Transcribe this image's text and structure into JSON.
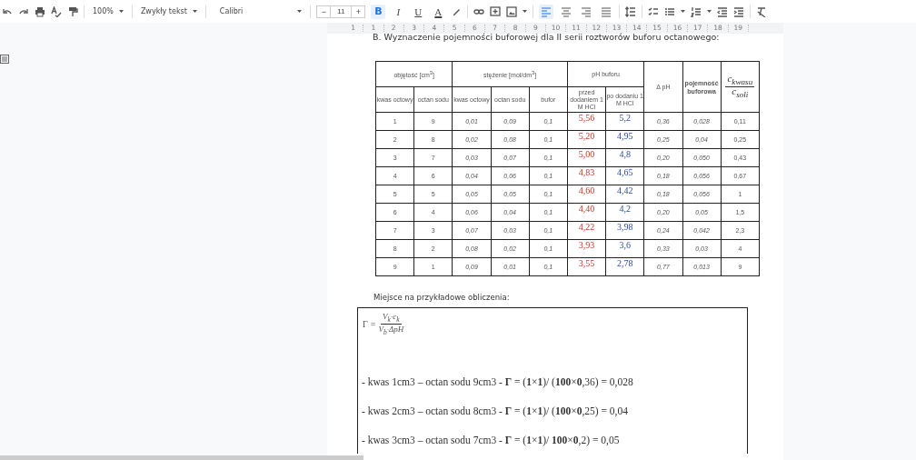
{
  "toolbar": {
    "zoom": "100%",
    "paragraph_style": "Zwykły tekst",
    "font": "Calibri",
    "font_size": "11",
    "size_decrease": "−",
    "size_increase": "+",
    "format_buttons": [
      {
        "kind": "bold",
        "label": "B",
        "selected": true
      },
      {
        "kind": "italic",
        "label": "I",
        "selected": false
      },
      {
        "kind": "underline",
        "label": "U",
        "selected": false
      },
      {
        "kind": "color",
        "label": "A",
        "selected": false
      }
    ],
    "alignment": [
      {
        "kind": "left",
        "selected": true
      },
      {
        "kind": "center",
        "selected": false
      },
      {
        "kind": "right",
        "selected": false
      },
      {
        "kind": "justify",
        "selected": false
      }
    ]
  },
  "ruler": {
    "labels": [
      "1",
      "1",
      "2",
      "3",
      "4",
      "5",
      "6",
      "7",
      "8",
      "9",
      "10",
      "11",
      "12",
      "13",
      "14",
      "15",
      "16",
      "17",
      "18",
      "19"
    ]
  },
  "document": {
    "heading": "B. Wyznaczenie pojemności buforowej dla II serii roztworów buforu octanowego:",
    "table": {
      "header_groups": [
        {
          "kind": "group",
          "label": "objętość [cm$^{3}$]",
          "columns": [
            "kwas octowy",
            "octan sodu"
          ]
        },
        {
          "kind": "group",
          "label": "stężenie [mol/dm$^{3}$]",
          "columns": [
            "kwas octowy",
            "octan sodu",
            "bufor"
          ]
        },
        {
          "kind": "group",
          "label": "pH buforu",
          "columns": [
            "przed dodaniem 1 M HCl",
            "po dodaniu 1 M HCl"
          ]
        },
        {
          "kind": "single",
          "label": "Δ pH"
        },
        {
          "kind": "single",
          "label": "pojemność buforowa"
        },
        {
          "kind": "fraction",
          "numerator": "c$_{kwasu}$",
          "denominator": "c$_{soli}$"
        }
      ],
      "rows": [
        [
          "1",
          "9",
          "0,01",
          "0,09",
          "0,1",
          "5,56",
          "5,2",
          "0,36",
          "0,028",
          "0,11"
        ],
        [
          "2",
          "8",
          "0,02",
          "0,08",
          "0,1",
          "5,20",
          "4,95",
          "0,25",
          "0,04",
          "0,25"
        ],
        [
          "3",
          "7",
          "0,03",
          "0,07",
          "0,1",
          "5,00",
          "4,8",
          "0,20",
          "0,050",
          "0,43"
        ],
        [
          "4",
          "6",
          "0,04",
          "0,06",
          "0,1",
          "4,83",
          "4,65",
          "0,18",
          "0,056",
          "0,67"
        ],
        [
          "5",
          "5",
          "0,05",
          "0,05",
          "0,1",
          "4,60",
          "4,42",
          "0,18",
          "0,056",
          "1"
        ],
        [
          "6",
          "4",
          "0,06",
          "0,04",
          "0,1",
          "4,40",
          "4,2",
          "0,20",
          "0,05",
          "1,5"
        ],
        [
          "7",
          "3",
          "0,07",
          "0,03",
          "0,1",
          "4,22",
          "3,98",
          "0,24",
          "0,042",
          "2,3"
        ],
        [
          "8",
          "2",
          "0,08",
          "0,02",
          "0,1",
          "3,93",
          "3,6",
          "0,33",
          "0,03",
          "4"
        ],
        [
          "9",
          "1",
          "0,09",
          "0,01",
          "0,1",
          "3,55",
          "2,78",
          "0,77",
          "0,013",
          "9"
        ]
      ]
    },
    "calc_label": "Miejsce na przykładowe obliczenia:",
    "formula": {
      "symbol": "Γ",
      "equals": "=",
      "numerator": "V$_{k}$·c$_{k}$",
      "denominator": "V$_{b}$·ΔpH"
    },
    "calc_lines": [
      "- kwas 1cm3 – octan sodu 9cm3 - **Γ** = (**1**×**1**)/ (**100**×**0**,36) = 0,028",
      "- kwas 2cm3 – octan sodu 8cm3 - **Γ** = (**1**×**1**)/ (**100**×**0**,25) = 0,04",
      "- kwas 3cm3 – octan sodu 7cm3 - **Γ** = (**1**×**1**)/ **100**×**0**,2) = 0,05"
    ]
  }
}
